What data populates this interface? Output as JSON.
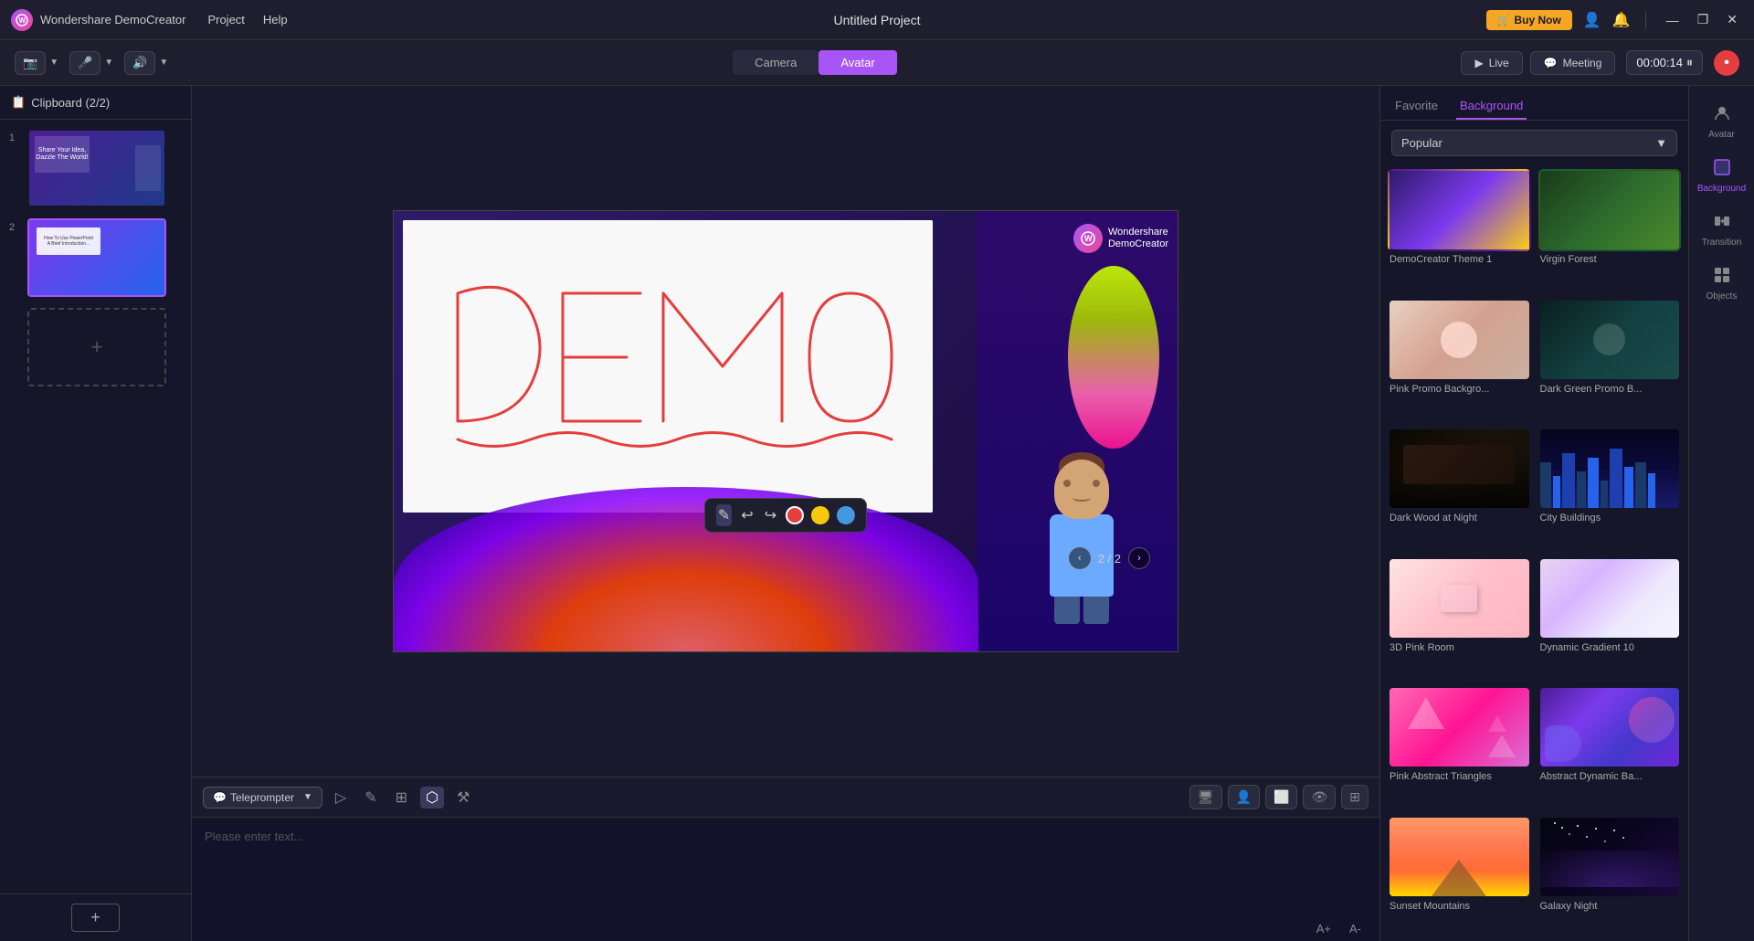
{
  "app": {
    "name": "Wondershare DemoCreator",
    "project_title": "Untitled Project"
  },
  "titlebar": {
    "logo_letter": "W",
    "app_name": "Wondershare DemoCreator",
    "menu_items": [
      "Project",
      "Help"
    ],
    "buy_now": "Buy Now",
    "project_title": "Untitled Project",
    "minimize": "—",
    "maximize": "❐",
    "close": "✕"
  },
  "toolbar": {
    "camera_label": "Camera",
    "avatar_label": "Avatar",
    "live_label": "Live",
    "meeting_label": "Meeting",
    "timer": "00:00:14"
  },
  "left_panel": {
    "header": "Clipboard (2/2)",
    "clip1_num": "1",
    "clip2_num": "2",
    "add_scene_label": "+"
  },
  "canvas": {
    "page_current": "2",
    "page_total": "2",
    "page_display": "2 / 2",
    "dc_logo_line1": "Wondershare",
    "dc_logo_line2": "DemoCreator"
  },
  "drawing_toolbar": {
    "tools": [
      "✎",
      "↩",
      "↪"
    ],
    "colors": [
      "red",
      "yellow",
      "blue"
    ]
  },
  "teleprompter": {
    "label": "Teleprompter",
    "placeholder": "Please enter text...",
    "tools": [
      "▷",
      "✎",
      "⊞",
      "⬡",
      "⚒"
    ]
  },
  "right_panel": {
    "tab_favorite": "Favorite",
    "tab_background": "Background",
    "filter_label": "Popular",
    "backgrounds": [
      {
        "id": "democreator-theme-1",
        "label": "DemoCreator Theme 1",
        "class": "bg-democreator",
        "fav": false
      },
      {
        "id": "virgin-forest",
        "label": "Virgin Forest",
        "class": "bg-virgin-forest",
        "fav": false
      },
      {
        "id": "pink-promo",
        "label": "Pink Promo Backgro...",
        "class": "bg-pink-promo",
        "fav": false
      },
      {
        "id": "dark-green-promo",
        "label": "Dark Green Promo B...",
        "class": "bg-dark-green-promo",
        "fav": false
      },
      {
        "id": "dark-wood",
        "label": "Dark Wood at Night",
        "class": "bg-dark-wood",
        "fav": true
      },
      {
        "id": "city-buildings",
        "label": "City Buildings",
        "class": "bg-city-buildings",
        "fav": false
      },
      {
        "id": "3d-pink-room",
        "label": "3D Pink Room",
        "class": "bg-3d-pink",
        "fav": false
      },
      {
        "id": "dynamic-gradient-10",
        "label": "Dynamic Gradient 10",
        "class": "bg-dynamic-gradient",
        "fav": false
      },
      {
        "id": "pink-abstract-triangles",
        "label": "Pink Abstract Triangles",
        "class": "bg-pink-triangles",
        "fav": false
      },
      {
        "id": "abstract-dynamic-ba",
        "label": "Abstract Dynamic Ba...",
        "class": "bg-abstract-dynamic",
        "fav": true
      },
      {
        "id": "sunset",
        "label": "Sunset Mountains",
        "class": "bg-sunset",
        "fav": false
      },
      {
        "id": "galaxy",
        "label": "Galaxy Night",
        "class": "bg-galaxy",
        "fav": false
      }
    ]
  },
  "right_sidebar": {
    "items": [
      {
        "id": "avatar",
        "label": "Avatar",
        "icon": "👤"
      },
      {
        "id": "background",
        "label": "Background",
        "icon": "🖼"
      },
      {
        "id": "transition",
        "label": "Transition",
        "icon": "⇄"
      },
      {
        "id": "objects",
        "label": "Objects",
        "icon": "⊞"
      }
    ]
  }
}
